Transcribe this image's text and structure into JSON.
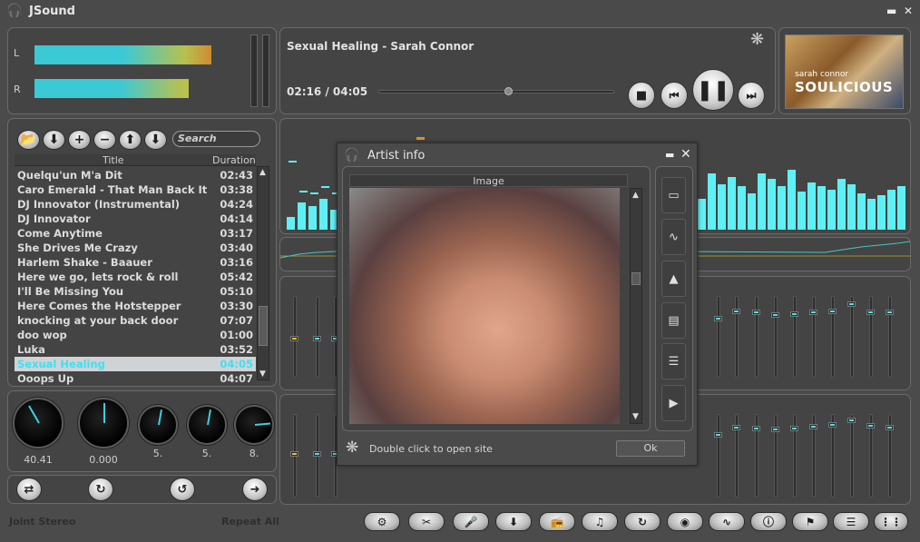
{
  "app": {
    "title": "JSound",
    "min_icon": "minimize-icon",
    "close_icon": "close-icon"
  },
  "meters": {
    "left_label": "L",
    "right_label": "R",
    "left_level": 0.86,
    "right_level": 0.74
  },
  "player": {
    "now_playing": "Sexual Healing - Sarah Connor",
    "time": "02:16 / 04:05",
    "progress": 0.55,
    "album": {
      "artist": "sarah connor",
      "title": "SOULICIOUS"
    }
  },
  "playlist": {
    "search_placeholder": "Search",
    "col_title": "Title",
    "col_duration": "Duration",
    "rows": [
      {
        "title": "Quelqu'un M'a Dit",
        "duration": "02:43"
      },
      {
        "title": "Caro Emerald - That Man   Back It U...",
        "duration": "03:38"
      },
      {
        "title": "DJ Innovator (Instrumental)",
        "duration": "04:24"
      },
      {
        "title": "DJ Innovator",
        "duration": "04:14"
      },
      {
        "title": "Come Anytime",
        "duration": "03:17"
      },
      {
        "title": "She Drives Me Crazy",
        "duration": "03:40"
      },
      {
        "title": "Harlem Shake - Baauer",
        "duration": "03:16"
      },
      {
        "title": "Here we go, lets rock & roll",
        "duration": "05:42"
      },
      {
        "title": "I'll Be Missing You",
        "duration": "05:10"
      },
      {
        "title": "Here Comes the Hotstepper",
        "duration": "03:30"
      },
      {
        "title": "knocking at your back door",
        "duration": "07:07"
      },
      {
        "title": "doo wop",
        "duration": "01:00"
      },
      {
        "title": "Luka",
        "duration": "03:52"
      },
      {
        "title": "Sexual Healing",
        "duration": "04:05"
      },
      {
        "title": "Ooops Up",
        "duration": "04:07"
      }
    ]
  },
  "knobs": [
    {
      "value": "40.41"
    },
    {
      "value": "0.000"
    },
    {
      "value": "5."
    },
    {
      "value": "5."
    },
    {
      "value": "8."
    }
  ],
  "status": {
    "left": "Joint Stereo",
    "right": "Repeat All"
  },
  "artist_dialog": {
    "title": "Artist info",
    "image_header": "Image",
    "footer": "Double click to open site",
    "ok": "Ok"
  }
}
